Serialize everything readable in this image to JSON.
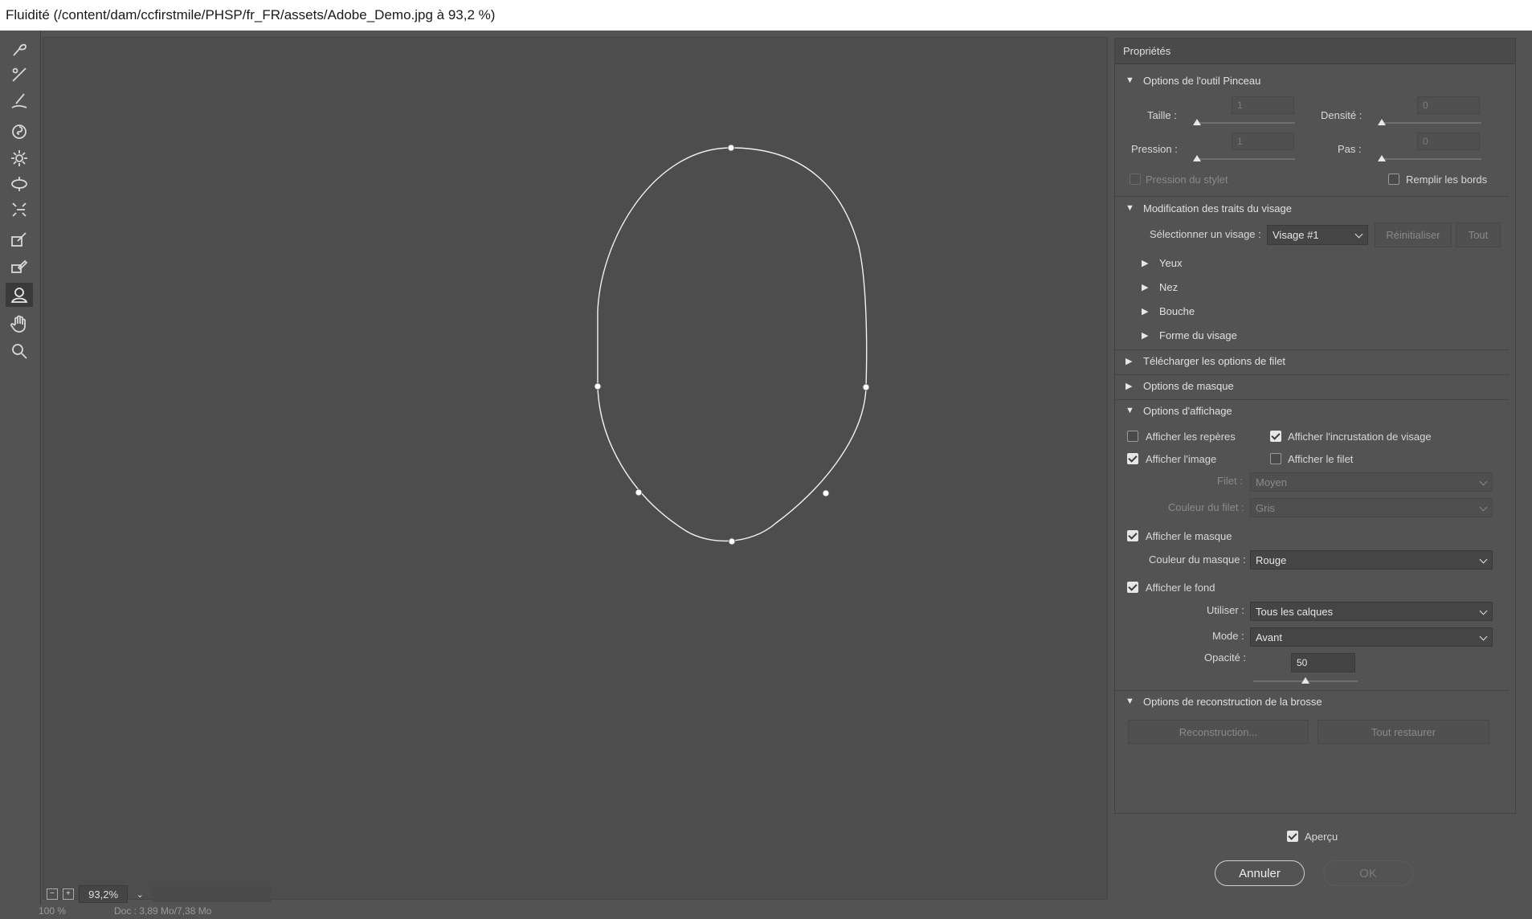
{
  "window": {
    "title": "Fluidité (/content/dam/ccfirstmile/PHSP/fr_FR/assets/Adobe_Demo.jpg à 93,2 %)"
  },
  "toolbar": {
    "tools": [
      {
        "name": "forward-warp-icon"
      },
      {
        "name": "reconstruct-icon"
      },
      {
        "name": "smooth-icon"
      },
      {
        "name": "twirl-icon"
      },
      {
        "name": "pucker-icon"
      },
      {
        "name": "bloat-icon"
      },
      {
        "name": "push-left-icon"
      },
      {
        "name": "freeze-mask-icon"
      },
      {
        "name": "thaw-mask-icon"
      },
      {
        "name": "face-tool-icon",
        "active": true
      },
      {
        "name": "hand-icon"
      },
      {
        "name": "zoom-icon"
      }
    ]
  },
  "canvas": {
    "zoom_value": "93,2%"
  },
  "properties": {
    "header": "Propriétés",
    "brush": {
      "title": "Options de l'outil Pinceau",
      "size_label": "Taille :",
      "size_value": "1",
      "density_label": "Densité :",
      "density_value": "0",
      "pressure_label": "Pression :",
      "pressure_value": "1",
      "rate_label": "Pas :",
      "rate_value": "0",
      "stylus_label": "Pression du stylet",
      "pin_edges_label": "Remplir les bords"
    },
    "face": {
      "title": "Modification des traits du visage",
      "select_label": "Sélectionner un visage :",
      "select_value": "Visage #1",
      "reset_label": "Réinitialiser",
      "all_label": "Tout",
      "items": [
        "Yeux",
        "Nez",
        "Bouche",
        "Forme du visage"
      ]
    },
    "load_mesh_title": "Télécharger les options de filet",
    "mask_title": "Options de masque",
    "view": {
      "title": "Options d'affichage",
      "show_guides": "Afficher les repères",
      "show_face_overlay": "Afficher l'incrustation de visage",
      "show_image": "Afficher l'image",
      "show_mesh": "Afficher le filet",
      "mesh_size_label": "Filet :",
      "mesh_size_value": "Moyen",
      "mesh_color_label": "Couleur du filet :",
      "mesh_color_value": "Gris",
      "show_mask": "Afficher le masque",
      "mask_color_label": "Couleur du masque :",
      "mask_color_value": "Rouge",
      "show_backdrop": "Afficher le fond",
      "use_label": "Utiliser :",
      "use_value": "Tous les calques",
      "mode_label": "Mode :",
      "mode_value": "Avant",
      "opacity_label": "Opacité :",
      "opacity_value": "50"
    },
    "reconstruct": {
      "title": "Options de reconstruction de la brosse",
      "reconstruct_label": "Reconstruction...",
      "restore_all_label": "Tout restaurer"
    }
  },
  "footer": {
    "preview_label": "Aperçu",
    "cancel_label": "Annuler",
    "ok_label": "OK"
  },
  "status": {
    "zoom": "100 %",
    "doc": "Doc : 3,89 Mo/7,38 Mo"
  }
}
